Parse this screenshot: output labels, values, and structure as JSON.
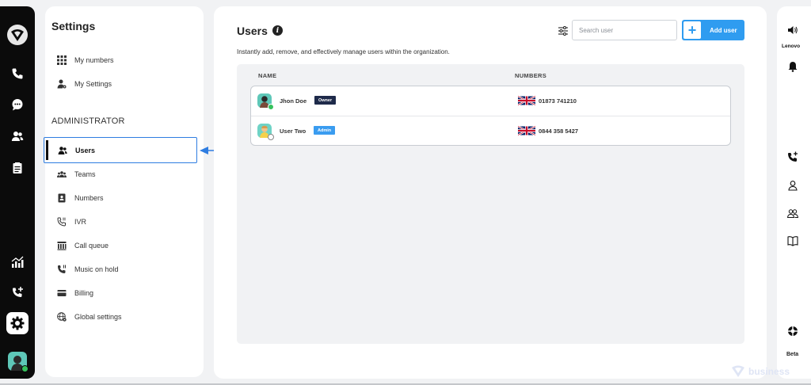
{
  "settings": {
    "title": "Settings",
    "personal_items": [
      {
        "label": "My numbers",
        "icon": "grid-icon"
      },
      {
        "label": "My Settings",
        "icon": "user-gear-icon"
      }
    ],
    "admin_title": "ADMINISTRATOR",
    "admin_items": [
      {
        "label": "Users",
        "icon": "users-icon",
        "active": true
      },
      {
        "label": "Teams",
        "icon": "teams-icon"
      },
      {
        "label": "Numbers",
        "icon": "number-book-icon"
      },
      {
        "label": "IVR",
        "icon": "ivr-phone-icon"
      },
      {
        "label": "Call queue",
        "icon": "call-queue-icon"
      },
      {
        "label": "Music on hold",
        "icon": "music-hold-phone-icon"
      },
      {
        "label": "Billing",
        "icon": "credit-card-icon"
      },
      {
        "label": "Global settings",
        "icon": "globe-gear-icon"
      }
    ]
  },
  "main": {
    "title": "Users",
    "subtitle": "Instantly add, remove, and effectively manage users within the organization.",
    "search_placeholder": "Search user",
    "add_button_label": "Add user",
    "table": {
      "columns": [
        "NAME",
        "NUMBERS"
      ],
      "rows": [
        {
          "name": "Jhon Doe",
          "badge": "Owner",
          "badge_color": "#1e2a4a",
          "number": "01873 741210",
          "status": "online",
          "avatar_color": "#5ec7b8"
        },
        {
          "name": "User Two",
          "badge": "Admin",
          "badge_color": "#3a9cf0",
          "number": "0844 358 5427",
          "status": "offline",
          "avatar_color": "#6fd3c6"
        }
      ]
    }
  },
  "right_rail": {
    "device_label": "Lenovo",
    "beta_label": "Beta"
  },
  "watermark": {
    "text": "business"
  },
  "colors": {
    "accent": "#2f9cf0",
    "active_border": "#2f7de1",
    "online": "#35c15c"
  }
}
